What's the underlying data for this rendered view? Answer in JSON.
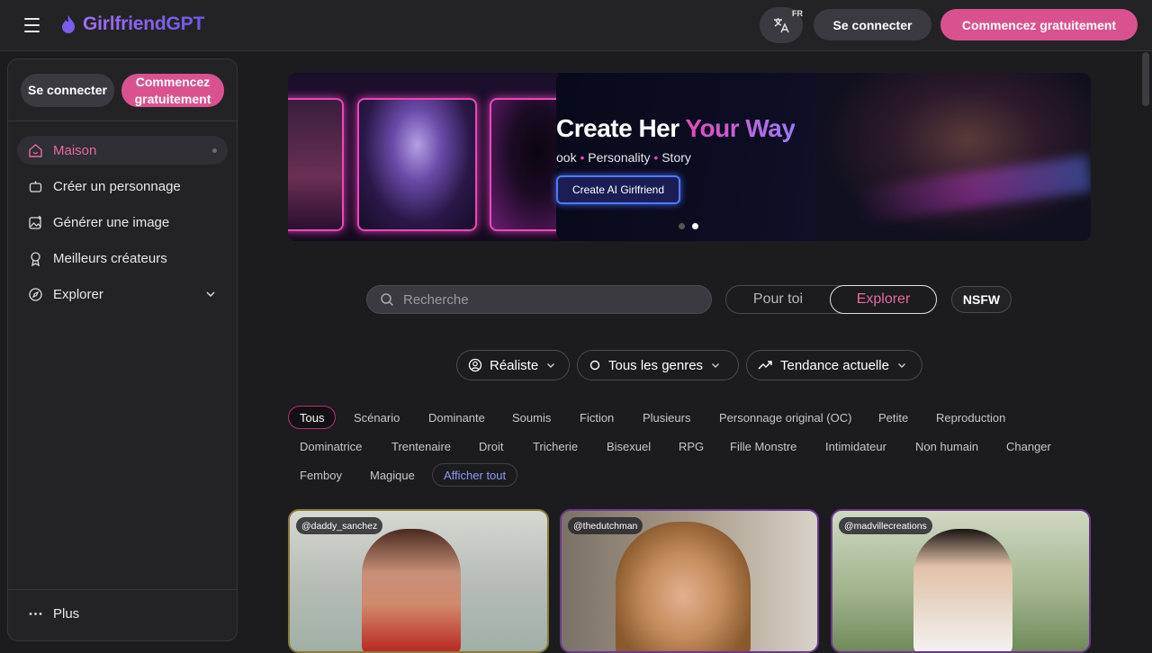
{
  "header": {
    "logo_text": "GirlfriendGPT",
    "lang_code": "FR",
    "connect_label": "Se connecter",
    "start_label": "Commencez gratuitement"
  },
  "sidebar": {
    "connect_label": "Se connecter",
    "start_label": "Commencez gratuitement",
    "items": [
      {
        "label": "Maison",
        "icon": "home-icon",
        "active": true
      },
      {
        "label": "Créer un personnage",
        "icon": "robot-icon"
      },
      {
        "label": "Générer une image",
        "icon": "image-plus-icon"
      },
      {
        "label": "Meilleurs créateurs",
        "icon": "award-icon"
      },
      {
        "label": "Explorer",
        "icon": "compass-icon"
      }
    ],
    "more_label": "Plus"
  },
  "banner": {
    "title_part1": "Create Her ",
    "title_part2": "Your Way",
    "subtitle_part1": "ook ",
    "subtitle_sep": "•",
    "subtitle_part2": " Personality ",
    "subtitle_part3": " Story",
    "cta_label": "Create AI Girlfriend",
    "slide_count": 2,
    "active_slide": 2
  },
  "search": {
    "placeholder": "Recherche",
    "value": ""
  },
  "segment": {
    "option_a": "Pour toi",
    "option_b": "Explorer",
    "selected": "Explorer"
  },
  "nsfw_label": "NSFW",
  "filters": {
    "style": "Réaliste",
    "gender": "Tous les genres",
    "sort": "Tendance actuelle"
  },
  "tags": {
    "row1": [
      "Tous",
      "Scénario",
      "Dominante",
      "Soumis",
      "Fiction",
      "Plusieurs",
      "Personnage original (OC)",
      "Petite",
      "Reproduction"
    ],
    "row2": [
      "Dominatrice",
      "Trentenaire",
      "Droit",
      "Tricherie",
      "Bisexuel",
      "RPG",
      "Fille Monstre",
      "Intimidateur",
      "Non humain",
      "Changer"
    ],
    "row3": [
      "Femboy",
      "Magique"
    ],
    "show_all": "Afficher tout",
    "selected": "Tous"
  },
  "cards": [
    {
      "handle": "@daddy_sanchez"
    },
    {
      "handle": "@thedutchman"
    },
    {
      "handle": "@madvillecreations"
    }
  ],
  "colors": {
    "accent": "#d9528f",
    "brand": "#7c5cf0",
    "bg": "#1c1c1f",
    "panel": "#232326"
  }
}
